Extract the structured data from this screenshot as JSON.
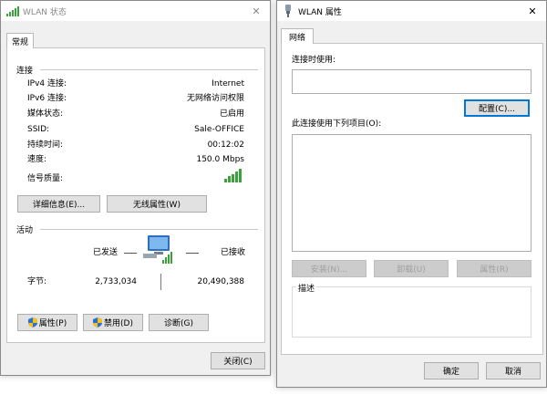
{
  "status_dialog": {
    "title": "WLAN 状态",
    "close_glyph": "✕",
    "tab": "常规",
    "connection": {
      "heading": "连接",
      "rows": [
        {
          "label": "IPv4 连接:",
          "value": "Internet"
        },
        {
          "label": "IPv6 连接:",
          "value": "无网络访问权限"
        },
        {
          "label": "媒体状态:",
          "value": "已启用"
        },
        {
          "label": "SSID:",
          "value": "Sale-OFFICE"
        },
        {
          "label": "持续时间:",
          "value": "00:12:02"
        },
        {
          "label": "速度:",
          "value": "150.0 Mbps"
        }
      ],
      "signal_label": "信号质量:",
      "signal_bars": 5,
      "details_button": "详细信息(E)...",
      "wireless_props_button": "无线属性(W)"
    },
    "activity": {
      "heading": "活动",
      "sent_label": "已发送",
      "received_label": "已接收",
      "bytes_label": "字节:",
      "bytes_sent": "2,733,034",
      "bytes_received": "20,490,388"
    },
    "properties_button": "属性(P)",
    "disable_button": "禁用(D)",
    "diagnose_button": "诊断(G)",
    "close_button": "关闭(C)"
  },
  "props_dialog": {
    "title": "WLAN 属性",
    "close_glyph": "✕",
    "tab": "网络",
    "connect_using_label": "连接时使用:",
    "configure_button": "配置(C)...",
    "items_label": "此连接使用下列项目(O):",
    "install_button": "安装(N)...",
    "uninstall_button": "卸载(U)",
    "properties_button": "属性(R)",
    "description_label": "描述",
    "ok_button": "确定",
    "cancel_button": "取消"
  },
  "colors": {
    "signal_green": "#3aa23a",
    "focus_blue": "#0078d7",
    "shield_blue": "#2a6fd6",
    "shield_yellow": "#f2c21b"
  }
}
